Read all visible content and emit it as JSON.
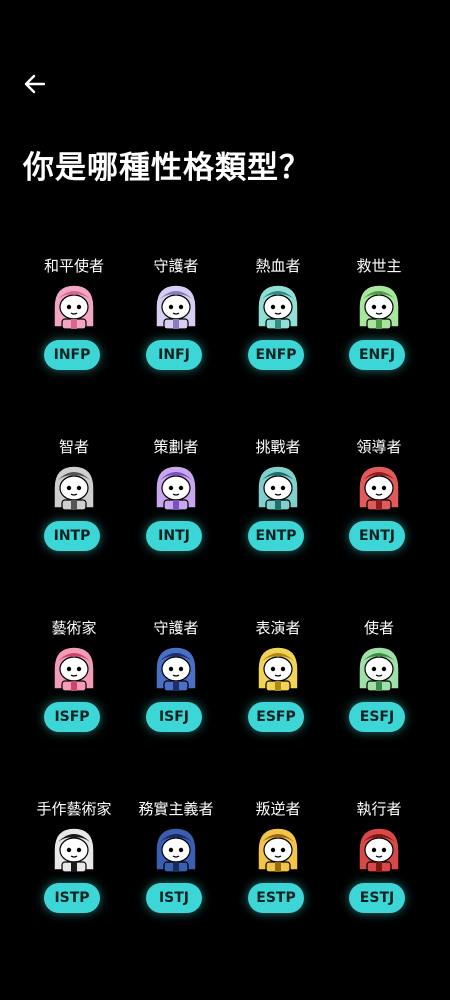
{
  "header": {
    "title": "你是哪種性格類型？"
  },
  "badge_color": "#3dd6d6",
  "types": [
    {
      "name": "和平使者",
      "code": "INFP",
      "icon": "pink-hat-mascot-icon",
      "color": "#f2a5c4",
      "accent": "#d9668f"
    },
    {
      "name": "守護者",
      "code": "INFJ",
      "icon": "lavender-wand-mascot-icon",
      "color": "#d8cdf2",
      "accent": "#8a7bbd"
    },
    {
      "name": "熱血者",
      "code": "ENFP",
      "icon": "teal-fairy-mascot-icon",
      "color": "#8fdfd6",
      "accent": "#2f8f86"
    },
    {
      "name": "救世主",
      "code": "ENFJ",
      "icon": "green-crown-mascot-icon",
      "color": "#a8e6a0",
      "accent": "#4f9e48"
    },
    {
      "name": "智者",
      "code": "INTP",
      "icon": "grey-scholar-mascot-icon",
      "color": "#cfcfcf",
      "accent": "#555555"
    },
    {
      "name": "策劃者",
      "code": "INTJ",
      "icon": "purple-twintail-mascot-icon",
      "color": "#c9a6ef",
      "accent": "#7a4fbf"
    },
    {
      "name": "挑戰者",
      "code": "ENTP",
      "icon": "teal-bun-mascot-icon",
      "color": "#7fd0cc",
      "accent": "#1f6f6a"
    },
    {
      "name": "領導者",
      "code": "ENTJ",
      "icon": "red-hair-mascot-icon",
      "color": "#e05a5a",
      "accent": "#8e1e1e"
    },
    {
      "name": "藝術家",
      "code": "ISFP",
      "icon": "pink-beret-mascot-icon",
      "color": "#f39cb7",
      "accent": "#c9466f"
    },
    {
      "name": "守護者",
      "code": "ISFJ",
      "icon": "navy-nurse-mascot-icon",
      "color": "#4a6fc4",
      "accent": "#1d2f6a"
    },
    {
      "name": "表演者",
      "code": "ESFP",
      "icon": "yellow-hat-mascot-icon",
      "color": "#f2d35a",
      "accent": "#b08a12"
    },
    {
      "name": "使者",
      "code": "ESFJ",
      "icon": "green-cheer-mascot-icon",
      "color": "#9fe0a8",
      "accent": "#3b8a46"
    },
    {
      "name": "手作藝術家",
      "code": "ISTP",
      "icon": "black-hammer-mascot-icon",
      "color": "#e8e8e8",
      "accent": "#1a1a1a"
    },
    {
      "name": "務實主義者",
      "code": "ISTJ",
      "icon": "navy-glasses-mascot-icon",
      "color": "#3b5fb0",
      "accent": "#162a5e"
    },
    {
      "name": "叛逆者",
      "code": "ESTP",
      "icon": "yellow-cap-mascot-icon",
      "color": "#f2c44a",
      "accent": "#9a6a12"
    },
    {
      "name": "執行者",
      "code": "ESTJ",
      "icon": "red-cap-mascot-icon",
      "color": "#d94848",
      "accent": "#7e1616"
    }
  ]
}
